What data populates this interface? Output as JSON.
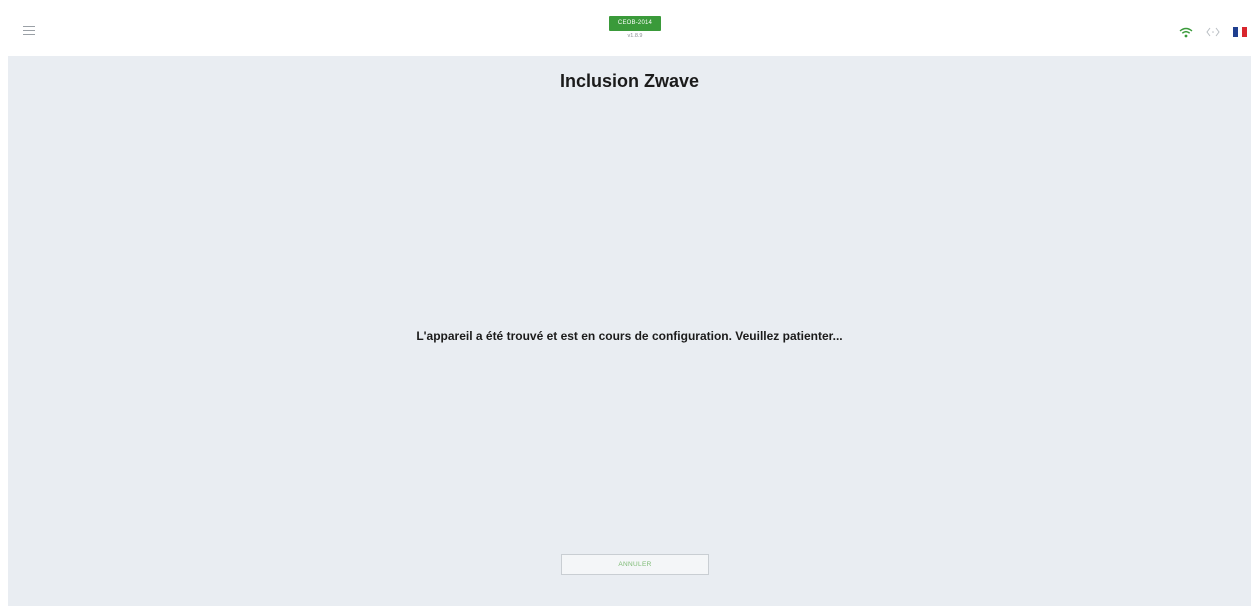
{
  "header": {
    "device_name": "CEOB-2014",
    "version": "v1.8.9",
    "icons": [
      "menu-icon",
      "wifi-icon",
      "connection-icon",
      "french-flag-icon"
    ],
    "wifi_color": "#3a9a3a",
    "badge_color": "#3a9a3a",
    "flag_colors": [
      "#1f3f8f",
      "#ffffff",
      "#d8262d"
    ]
  },
  "main": {
    "title": "Inclusion Zwave",
    "message": "L'appareil a été trouvé et est en cours de configuration. Veuillez patienter...",
    "cancel_label": "ANNULER",
    "background_color": "#e9edf2"
  }
}
